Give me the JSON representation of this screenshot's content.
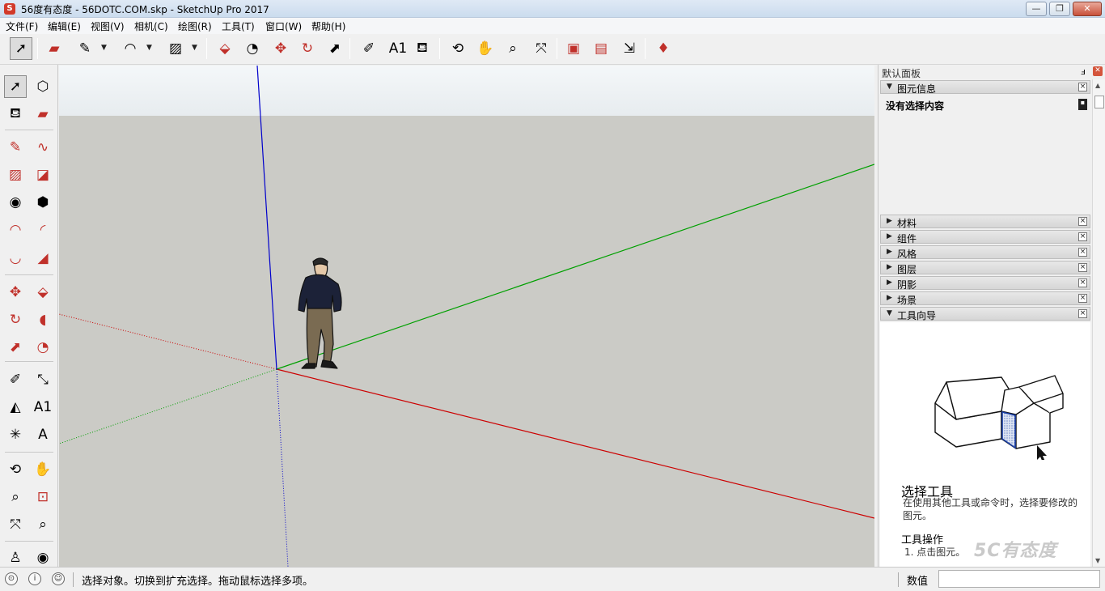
{
  "window": {
    "app_icon": "sketchup-logo-icon",
    "title": "56度有态度 - 56DOTC.COM.skp - SketchUp Pro 2017",
    "minimize": "—",
    "restore": "❐",
    "close": "✕"
  },
  "menu": [
    "文件(F)",
    "编辑(E)",
    "视图(V)",
    "相机(C)",
    "绘图(R)",
    "工具(T)",
    "窗口(W)",
    "帮助(H)"
  ],
  "toolbar": {
    "tools": [
      {
        "name": "select-icon",
        "glyph": "➚"
      },
      {
        "name": "eraser-icon",
        "glyph": "▰"
      },
      {
        "name": "pencil-icon",
        "glyph": "✎"
      },
      {
        "name": "arc-icon",
        "glyph": "◠"
      },
      {
        "name": "rectangle-icon",
        "glyph": "▨"
      },
      {
        "name": "push-pull-icon",
        "glyph": "⬙"
      },
      {
        "name": "offset-icon",
        "glyph": "◔"
      },
      {
        "name": "move-icon",
        "glyph": "✥"
      },
      {
        "name": "rotate-icon",
        "glyph": "↻"
      },
      {
        "name": "scale-icon",
        "glyph": "⬈"
      },
      {
        "name": "tape-measure-icon",
        "glyph": "✐"
      },
      {
        "name": "text-icon",
        "glyph": "A1"
      },
      {
        "name": "paint-bucket-icon",
        "glyph": "⛾"
      },
      {
        "name": "orbit-icon",
        "glyph": "⟲"
      },
      {
        "name": "pan-icon",
        "glyph": "✋"
      },
      {
        "name": "zoom-icon",
        "glyph": "⌕"
      },
      {
        "name": "zoom-extents-icon",
        "glyph": "⤧"
      },
      {
        "name": "3d-warehouse-icon",
        "glyph": "▣"
      },
      {
        "name": "extension-warehouse-icon",
        "glyph": "▤"
      },
      {
        "name": "layout-send-icon",
        "glyph": "⇲"
      },
      {
        "name": "ruby-console-icon",
        "glyph": "♦"
      }
    ]
  },
  "left_toolbar": {
    "tools": [
      {
        "name": "select-icon",
        "glyph": "➚"
      },
      {
        "name": "component-icon",
        "glyph": "⬡"
      },
      {
        "name": "paint-bucket-icon",
        "glyph": "⛾"
      },
      {
        "name": "eraser-icon",
        "glyph": "▰"
      },
      {
        "name": "line-icon",
        "glyph": "✎"
      },
      {
        "name": "freehand-icon",
        "glyph": "∿"
      },
      {
        "name": "rectangle-icon",
        "glyph": "▨"
      },
      {
        "name": "rotated-rectangle-icon",
        "glyph": "◪"
      },
      {
        "name": "circle-icon",
        "glyph": "◉"
      },
      {
        "name": "polygon-icon",
        "glyph": "⬢"
      },
      {
        "name": "arc-icon",
        "glyph": "◠"
      },
      {
        "name": "two-point-arc-icon",
        "glyph": "◜"
      },
      {
        "name": "three-point-arc-icon",
        "glyph": "◡"
      },
      {
        "name": "pie-icon",
        "glyph": "◢"
      },
      {
        "name": "move-icon",
        "glyph": "✥"
      },
      {
        "name": "push-pull-icon",
        "glyph": "⬙"
      },
      {
        "name": "rotate-icon",
        "glyph": "↻"
      },
      {
        "name": "follow-me-icon",
        "glyph": "◖"
      },
      {
        "name": "scale-icon",
        "glyph": "⬈"
      },
      {
        "name": "offset-icon",
        "glyph": "◔"
      },
      {
        "name": "tape-measure-icon",
        "glyph": "✐"
      },
      {
        "name": "dimension-icon",
        "glyph": "⤡"
      },
      {
        "name": "protractor-icon",
        "glyph": "◭"
      },
      {
        "name": "text-icon",
        "glyph": "A1"
      },
      {
        "name": "axes-icon",
        "glyph": "✳"
      },
      {
        "name": "3d-text-icon",
        "glyph": "A"
      },
      {
        "name": "orbit-icon",
        "glyph": "⟲"
      },
      {
        "name": "pan-icon",
        "glyph": "✋"
      },
      {
        "name": "zoom-icon",
        "glyph": "⌕"
      },
      {
        "name": "zoom-window-icon",
        "glyph": "⊡"
      },
      {
        "name": "zoom-extents-icon",
        "glyph": "⤧"
      },
      {
        "name": "previous-view-icon",
        "glyph": "⌕"
      },
      {
        "name": "position-camera-icon",
        "glyph": "♙"
      },
      {
        "name": "look-around-icon",
        "glyph": "◉"
      }
    ]
  },
  "viewport": {
    "background_color": "#cbcbc6",
    "sky_color": "#eef2f4",
    "axis_red": "#cc0000",
    "axis_green": "#00a000",
    "axis_blue": "#0000cc"
  },
  "tray": {
    "title": "默认面板",
    "pin": "ⅎ",
    "close": "✕",
    "entity_info": {
      "label": "图元信息",
      "expanded": true,
      "no_selection": "没有选择内容"
    },
    "panels": [
      {
        "label": "材料",
        "expanded": false
      },
      {
        "label": "组件",
        "expanded": false
      },
      {
        "label": "风格",
        "expanded": false
      },
      {
        "label": "图层",
        "expanded": false
      },
      {
        "label": "阴影",
        "expanded": false
      },
      {
        "label": "场景",
        "expanded": false
      },
      {
        "label": "工具向导",
        "expanded": true
      }
    ],
    "panel_close": "×",
    "instructor": {
      "title": "选择工具",
      "description": "在使用其他工具或命令时，选择要修改的图元。",
      "subtitle": "工具操作",
      "step": "1. 点击图元。",
      "watermark": "5C有态度"
    }
  },
  "status": {
    "icons": [
      "geo-location-icon",
      "info-icon",
      "user-icon"
    ],
    "message": "选择对象。切换到扩充选择。拖动鼠标选择多项。",
    "value_label": "数值",
    "value": ""
  }
}
